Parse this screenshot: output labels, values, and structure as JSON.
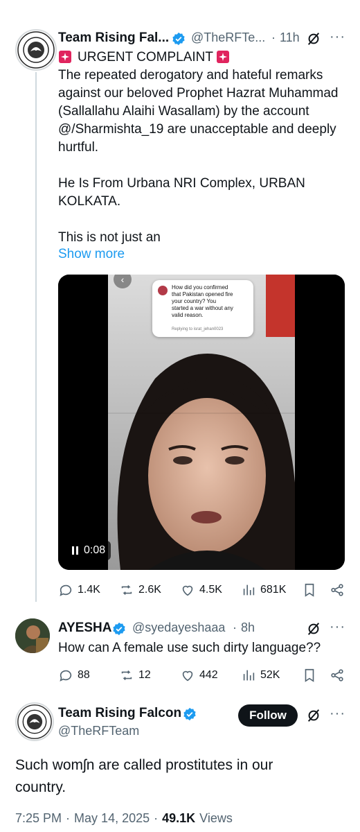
{
  "tweet1": {
    "name": "Team Rising Fal...",
    "handle": "@TheRFTe...",
    "dot": "·",
    "time": "11h",
    "more": "···",
    "lines": [
      "URGENT COMPLAINT",
      "The repeated derogatory and hateful remarks",
      "against our beloved Prophet Hazrat Muhammad",
      "(Sallallahu Alaihi Wasallam) by the account",
      "@/Sharmishta_19 are unacceptable and deeply",
      "hurtful.",
      "He Is From Urbana NRI Complex, URBAN",
      "KOLKATA.",
      "This is not just an"
    ],
    "show_more": "Show more",
    "video": {
      "question_lines": [
        "How did you confirmed",
        "that Pakistan opened fire",
        "your country?  You",
        "started a war without any",
        "valid reason."
      ],
      "reply_to": "Replying to israt_jehan0023",
      "timer": "0:08",
      "pause_icon": "pause-icon"
    },
    "stats": {
      "replies": "1.4K",
      "reposts": "2.6K",
      "likes": "4.5K",
      "views": "681K"
    }
  },
  "tweet2": {
    "name": "AYESHA",
    "handle": "@syedayeshaaa",
    "dot": "·",
    "time": "8h",
    "more": "···",
    "text": "How can A female use such dirty language??",
    "stats": {
      "replies": "88",
      "reposts": "12",
      "likes": "442",
      "views": "52K"
    }
  },
  "tweet3": {
    "name": "Team Rising Falcon",
    "handle": "@TheRFTeam",
    "follow": "Follow",
    "more": "···",
    "text_line1": "Such womʃn are called prostitutes in our",
    "text_line2": "country.",
    "time": "7:25 PM",
    "dot1": "·",
    "date": "May 14, 2025",
    "dot2": "·",
    "views_count": "49.1K",
    "views_label": "Views"
  },
  "colors": {
    "accent": "#1d9bf0",
    "text": "#0f1419",
    "muted": "#536471",
    "siren": "#e0245e"
  }
}
